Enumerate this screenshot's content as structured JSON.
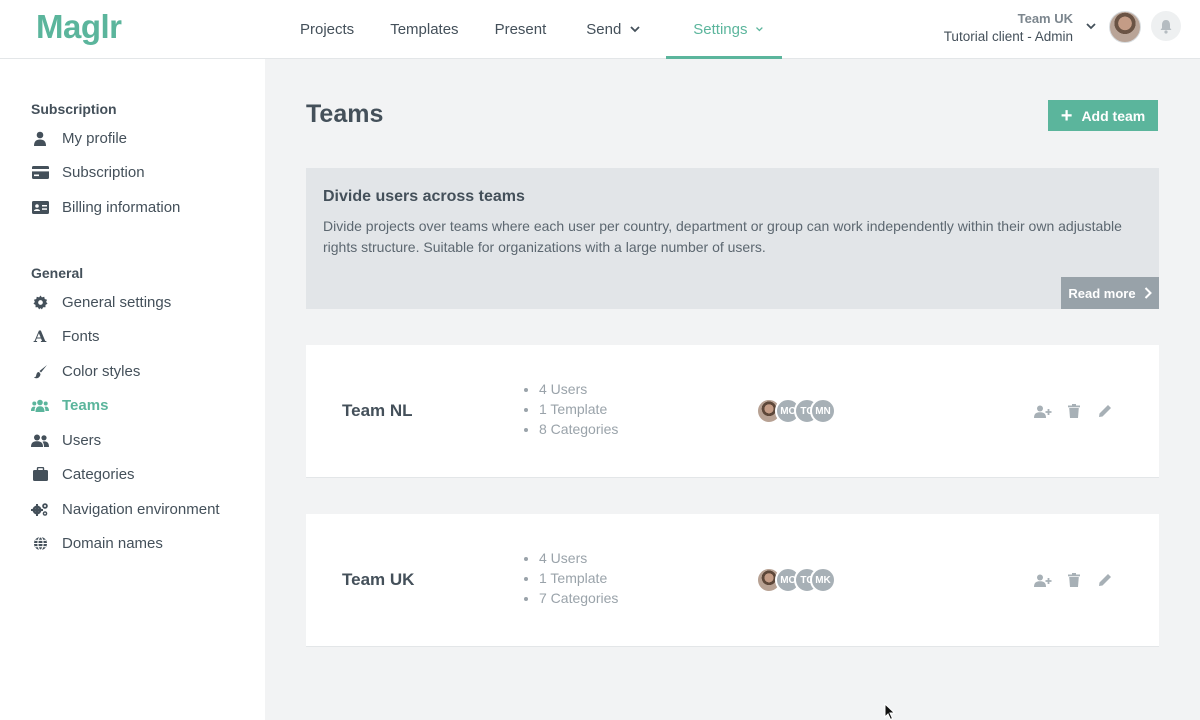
{
  "app": {
    "logo": "Maglr"
  },
  "nav": {
    "projects": "Projects",
    "templates": "Templates",
    "present": "Present",
    "send": "Send",
    "settings": "Settings"
  },
  "account": {
    "team": "Team UK",
    "client": "Tutorial client - Admin"
  },
  "sidebar": {
    "subscription_heading": "Subscription",
    "subscription_items": [
      {
        "label": "My profile",
        "icon": "user-icon"
      },
      {
        "label": "Subscription",
        "icon": "credit-card-icon"
      },
      {
        "label": "Billing information",
        "icon": "id-card-icon"
      }
    ],
    "general_heading": "General",
    "general_items": [
      {
        "label": "General settings",
        "icon": "gear-icon"
      },
      {
        "label": "Fonts",
        "icon": "font-icon"
      },
      {
        "label": "Color styles",
        "icon": "brush-icon"
      },
      {
        "label": "Teams",
        "icon": "users-group-icon"
      },
      {
        "label": "Users",
        "icon": "users-icon"
      },
      {
        "label": "Categories",
        "icon": "briefcase-icon"
      },
      {
        "label": "Navigation environment",
        "icon": "gears-icon"
      },
      {
        "label": "Domain names",
        "icon": "globe-icon"
      }
    ]
  },
  "main": {
    "title": "Teams",
    "add_team_label": "Add team",
    "info": {
      "title": "Divide users across teams",
      "text": "Divide projects over teams where each user per country, department or group can work independently within their own adjustable rights structure. Suitable for organizations with a large number of users.",
      "read_more": "Read more"
    },
    "teams": [
      {
        "name": "Team NL",
        "stats": [
          "4 Users",
          "1 Template",
          "8 Categories"
        ],
        "members": [
          "",
          "MC",
          "TC",
          "MN"
        ]
      },
      {
        "name": "Team UK",
        "stats": [
          "4 Users",
          "1 Template",
          "7 Categories"
        ],
        "members": [
          "",
          "MC",
          "TC",
          "MK"
        ]
      }
    ]
  },
  "colors": {
    "accent": "#5bb59c",
    "text": "#44505a",
    "muted": "#9aa3aa"
  }
}
